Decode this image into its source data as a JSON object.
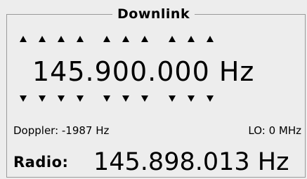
{
  "panel": {
    "title": "Downlink",
    "frequency": "145.900.000 Hz",
    "doppler": "Doppler: -1987 Hz",
    "lo": "LO: 0 MHz",
    "radio_label": "Radio:",
    "radio_frequency": "145.898.013 Hz"
  },
  "digit_arrows": {
    "up": [
      "digit-up",
      "digit-up",
      "digit-up",
      "digit-up",
      "digit-up",
      "digit-up",
      "digit-up",
      "digit-up",
      "digit-up",
      "digit-up"
    ],
    "down": [
      "digit-down",
      "digit-down",
      "digit-down",
      "digit-down",
      "digit-down",
      "digit-down",
      "digit-down",
      "digit-down",
      "digit-down",
      "digit-down"
    ],
    "icon_up": "triangle-up-icon",
    "icon_down": "triangle-down-icon"
  },
  "colors": {
    "background": "#ededed",
    "frame_border": "#9a9a9a",
    "text": "#000000"
  }
}
